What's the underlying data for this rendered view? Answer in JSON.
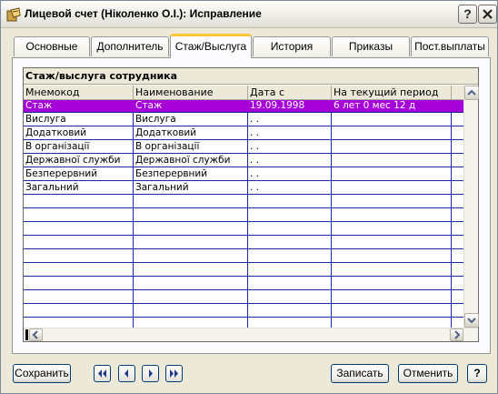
{
  "window": {
    "title": "Лицевой счет (Ніколенко О.І.): Исправление",
    "help_label": "?",
    "close_label": "✕"
  },
  "tabs": [
    {
      "label": "Основные",
      "active": false
    },
    {
      "label": "Дополнитель",
      "active": false
    },
    {
      "label": "Стаж/Выслуга",
      "active": true
    },
    {
      "label": "История",
      "active": false
    },
    {
      "label": "Приказы",
      "active": false
    },
    {
      "label": "Пост.выплаты",
      "active": false
    }
  ],
  "grid": {
    "caption": "Стаж/выслуга сотрудника",
    "columns": [
      "Мнемокод",
      "Наименование",
      "Дата с",
      "На текущий период"
    ],
    "rows": [
      {
        "mnemocode": "Стаж",
        "name": "Стаж",
        "date_from": "19.09.1998",
        "current": "6 лет  0 мес 12 д",
        "selected": true
      },
      {
        "mnemocode": "Вислуга",
        "name": "Вислуга",
        "date_from": ". .",
        "current": "",
        "selected": false
      },
      {
        "mnemocode": "Додатковий",
        "name": "Додатковий",
        "date_from": ". .",
        "current": "",
        "selected": false
      },
      {
        "mnemocode": "В організації",
        "name": "В організації",
        "date_from": ". .",
        "current": "",
        "selected": false
      },
      {
        "mnemocode": "Державної служби",
        "name": "Державної служби",
        "date_from": ". .",
        "current": "",
        "selected": false
      },
      {
        "mnemocode": "Безперервний",
        "name": "Безперервний",
        "date_from": ". .",
        "current": "",
        "selected": false
      },
      {
        "mnemocode": "Загальний",
        "name": "Загальний",
        "date_from": ". .",
        "current": "",
        "selected": false
      }
    ],
    "selected_color": "#A600D9",
    "grid_line_color": "#1C2AA8"
  },
  "footer": {
    "save_label": "Сохранить",
    "nav": {
      "first_icon": "first-record-icon",
      "prev_icon": "prev-record-icon",
      "next_icon": "next-record-icon",
      "last_icon": "last-record-icon"
    },
    "write_label": "Записать",
    "cancel_label": "Отменить",
    "help_label": "?"
  }
}
